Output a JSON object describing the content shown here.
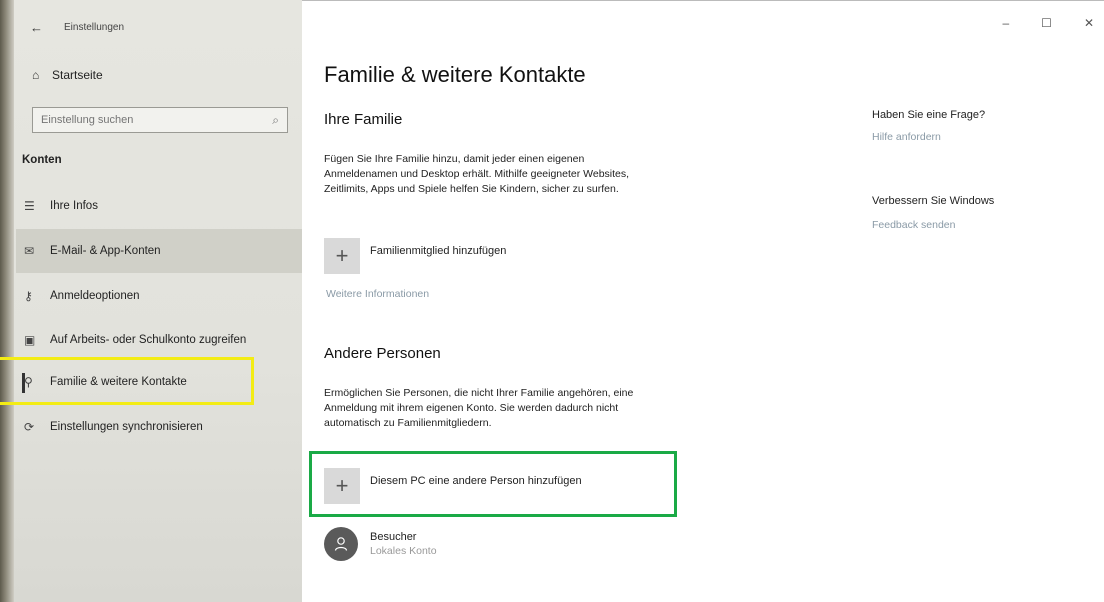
{
  "window": {
    "title": "Einstellungen",
    "controls": {
      "minimize": "–",
      "maximize": "☐",
      "close": "✕"
    }
  },
  "sidebar": {
    "home_label": "Startseite",
    "search_placeholder": "Einstellung suchen",
    "section_label": "Konten",
    "items": [
      {
        "label": "Ihre Infos",
        "icon": "person-card-icon"
      },
      {
        "label": "E-Mail- & App-Konten",
        "icon": "mail-icon"
      },
      {
        "label": "Anmeldeoptionen",
        "icon": "key-icon"
      },
      {
        "label": "Auf Arbeits- oder Schulkonto zugreifen",
        "icon": "briefcase-icon"
      },
      {
        "label": "Familie & weitere Kontakte",
        "icon": "people-icon"
      },
      {
        "label": "Einstellungen synchronisieren",
        "icon": "sync-icon"
      }
    ],
    "selected": "Familie & weitere Kontakte"
  },
  "main": {
    "title": "Familie & weitere Kontakte",
    "family": {
      "heading": "Ihre Familie",
      "description_lines": [
        "Fügen Sie Ihre Familie hinzu, damit jeder einen eigenen",
        "Anmeldenamen und Desktop erhält. Mithilfe geeigneter Websites,",
        "Zeitlimits, Apps und Spiele helfen Sie Kindern, sicher zu surfen."
      ],
      "add_label": "Familienmitglied hinzufügen",
      "more_info": "Weitere Informationen"
    },
    "others": {
      "heading": "Andere Personen",
      "description_lines": [
        "Ermöglichen Sie Personen, die nicht Ihrer Familie angehören, eine",
        "Anmeldung mit ihrem eigenen Konto. Sie werden dadurch nicht",
        "automatisch zu Familienmitgliedern."
      ],
      "add_label": "Diesem PC eine andere Person hinzufügen",
      "user": {
        "name": "Besucher",
        "type": "Lokales Konto"
      }
    }
  },
  "aside": {
    "question_heading": "Haben Sie eine Frage?",
    "help_link": "Hilfe anfordern",
    "improve_heading": "Verbessern Sie Windows",
    "feedback_link": "Feedback senden"
  },
  "annotations": {
    "yellow": "#f3ec14",
    "green": "#1aaa46"
  }
}
